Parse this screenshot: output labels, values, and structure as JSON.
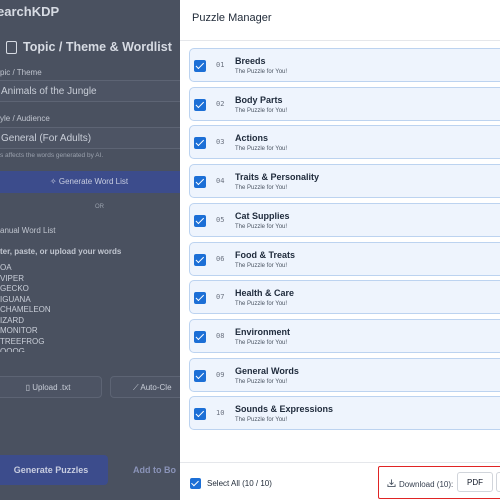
{
  "background": {
    "app_title": "earchKDP",
    "section_title": "Topic / Theme & Wordlist",
    "topic_label": "pic / Theme",
    "topic_value": "Animals of the Jungle",
    "style_label": "yle / Audience",
    "style_value": "General (For Adults)",
    "hint": "s affects the words generated by AI.",
    "generate_word_list": "Generate Word List",
    "or": "OR",
    "manual_label": "anual Word List",
    "manual_hint": "ter, paste, or upload your words",
    "words": [
      "OA",
      "VIPER",
      "GECKO",
      "IGUANA",
      "CHAMELEON",
      "IZARD",
      "MONITOR",
      "TREEFROG",
      "OOOG"
    ],
    "upload_button": "Upload .txt",
    "auto_clean_button": "Auto-Cle",
    "generate_puzzles": "Generate Puzzles",
    "add_to_book": "Add to Bo"
  },
  "modal": {
    "title": "Puzzle Manager",
    "items": [
      {
        "num": "01",
        "title": "Breeds",
        "subtitle": "The Puzzle for You!"
      },
      {
        "num": "02",
        "title": "Body Parts",
        "subtitle": "The Puzzle for You!"
      },
      {
        "num": "03",
        "title": "Actions",
        "subtitle": "The Puzzle for You!"
      },
      {
        "num": "04",
        "title": "Traits & Personality",
        "subtitle": "The Puzzle for You!"
      },
      {
        "num": "05",
        "title": "Cat Supplies",
        "subtitle": "The Puzzle for You!"
      },
      {
        "num": "06",
        "title": "Food & Treats",
        "subtitle": "The Puzzle for You!"
      },
      {
        "num": "07",
        "title": "Health & Care",
        "subtitle": "The Puzzle for You!"
      },
      {
        "num": "08",
        "title": "Environment",
        "subtitle": "The Puzzle for You!"
      },
      {
        "num": "09",
        "title": "General Words",
        "subtitle": "The Puzzle for You!"
      },
      {
        "num": "10",
        "title": "Sounds & Expressions",
        "subtitle": "The Puzzle for You!"
      }
    ],
    "footer": {
      "select_all": "Select All (10 / 10)",
      "download_label": "Download (10):",
      "format": "PDF"
    }
  },
  "colors": {
    "accent": "#1c6fd6",
    "item_bg": "#eef4fd",
    "item_border": "#bcd3f0",
    "highlight_border": "#e02424"
  },
  "icons": {
    "section": "document-icon",
    "generate": "sparkle-icon",
    "upload": "file-icon",
    "auto_clean": "wand-icon",
    "download": "download-icon",
    "checkbox": "check-icon"
  }
}
